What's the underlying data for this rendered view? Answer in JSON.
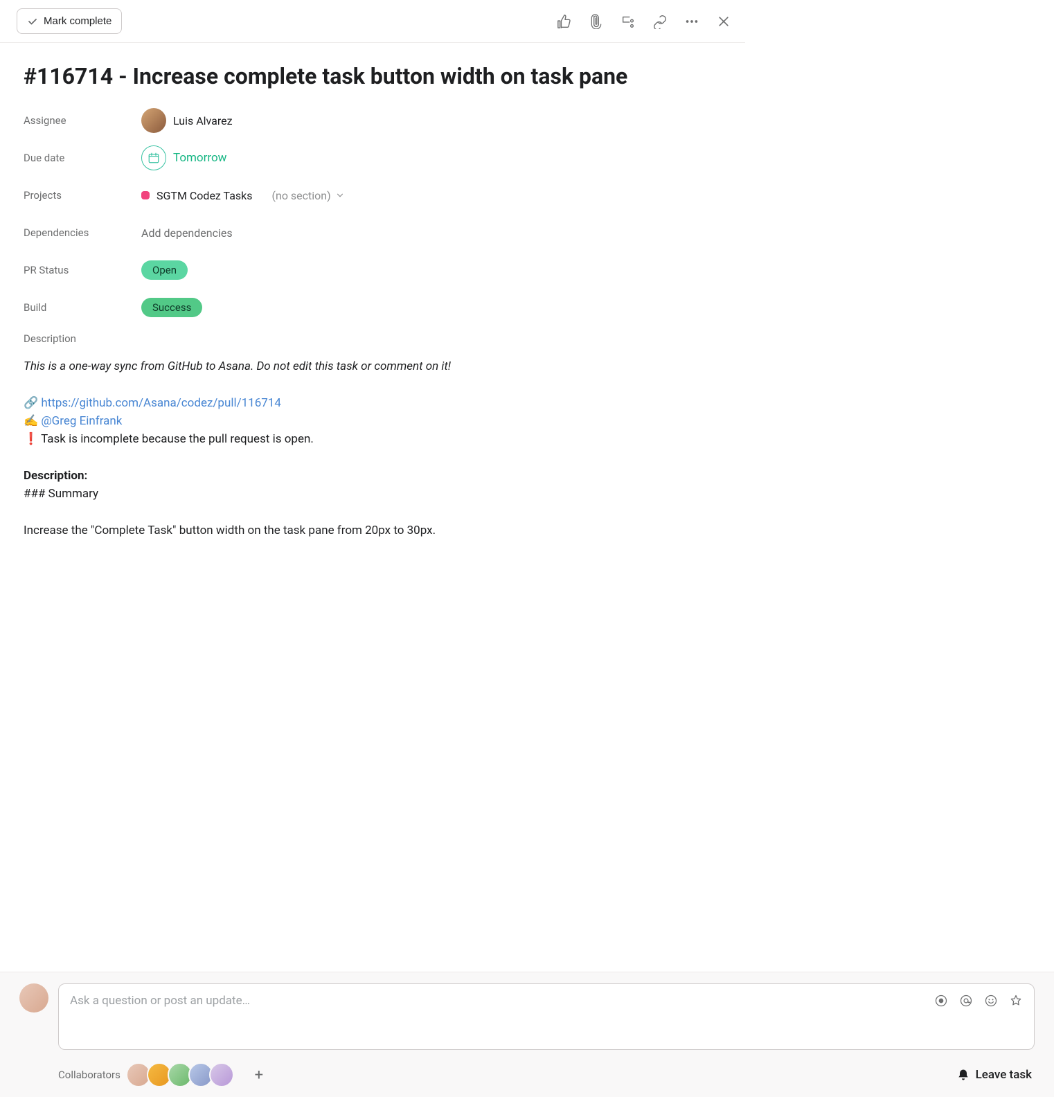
{
  "toolbar": {
    "mark_complete": "Mark complete"
  },
  "title": "#116714 - Increase complete task button width on task pane",
  "fields": {
    "assignee_label": "Assignee",
    "assignee_name": "Luis Alvarez",
    "due_label": "Due date",
    "due_value": "Tomorrow",
    "projects_label": "Projects",
    "project_name": "SGTM Codez Tasks",
    "project_section": "(no section)",
    "dependencies_label": "Dependencies",
    "dependencies_add": "Add dependencies",
    "pr_status_label": "PR Status",
    "pr_status_value": "Open",
    "build_label": "Build",
    "build_value": "Success",
    "description_label": "Description"
  },
  "description": {
    "sync_notice": "This is a one-way sync from GitHub to Asana. Do not edit this task or comment on it!",
    "link_emoji": "🔗",
    "link_url": "https://github.com/Asana/codez/pull/116714",
    "writer_emoji": "✍️",
    "mention": "@Greg Einfrank",
    "warn_emoji": "❗",
    "warn_text": "Task is incomplete because the pull request is open.",
    "desc_heading": "Description:",
    "summary_heading": "### Summary",
    "summary_body": "Increase the \"Complete Task\" button width on the task pane from 20px to 30px."
  },
  "comment": {
    "placeholder": "Ask a question or post an update…"
  },
  "footer": {
    "collaborators_label": "Collaborators",
    "leave_task": "Leave task"
  },
  "collaborator_count": 5
}
